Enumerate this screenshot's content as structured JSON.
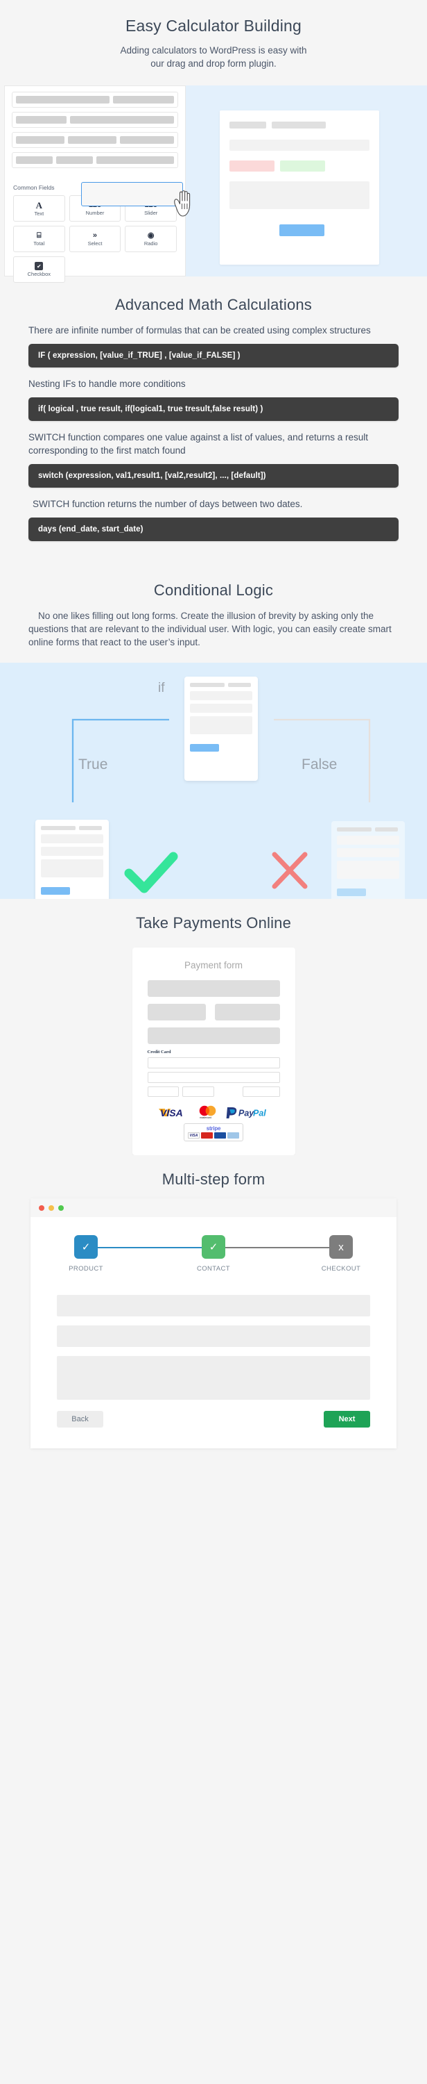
{
  "sections": {
    "calculator": {
      "title": "Easy Calculator Building",
      "subtitle": "Adding calculators to WordPress is easy with our drag and drop form plugin.",
      "builder": {
        "group_label": "Common Fields",
        "chevron": "⌄",
        "fields": [
          {
            "glyph": "A",
            "label": "Text"
          },
          {
            "glyph": "123",
            "label": "Number"
          },
          {
            "glyph": "123",
            "label": "Slider"
          },
          {
            "glyph": "⌸",
            "label": "Total"
          },
          {
            "glyph": "»",
            "label": "Select"
          },
          {
            "glyph": "◉",
            "label": "Radio"
          },
          {
            "glyph": "✔",
            "label": "Checkbox"
          }
        ]
      },
      "colors": {
        "panel_bg": "#e3f0fc",
        "drag_outline": "#4a9ae8",
        "submit_button": "#79bcf5",
        "error_field": "#fbd9d9",
        "success_field": "#ddf7dd"
      }
    },
    "math": {
      "title": "Advanced Math Calculations",
      "paragraphs": [
        "There are infinite number of formulas that can be created using complex structures",
        "Nesting IFs to handle more conditions",
        "SWITCH function compares one value against a list of values, and returns a result corresponding to the first match found",
        "SWITCH function returns the number of days between two dates."
      ],
      "code_blocks": [
        "IF ( expression, [value_if_TRUE] , [value_if_FALSE] )",
        "if( logical , true result, if(logical1, true tresult,false result) )",
        "switch (expression, val1,result1, [val2,result2], ..., [default])",
        "days (end_date, start_date)"
      ],
      "code_bg": "#3f3f3f"
    },
    "logic": {
      "title": "Conditional Logic",
      "subtitle": "No one likes filling out long forms. Create the illusion of brevity by asking only the questions that are relevant to the individual user. With logic, you can easily create smart online forms that react to the user’s input.",
      "diagram": {
        "if_label": "if",
        "true_label": "True",
        "false_label": "False",
        "true_color": "#6cb6ef",
        "false_color": "#e6e0dc",
        "check_color": "#35e59a",
        "cross_color": "#f2807e",
        "stage_bg": "#ddeefc"
      }
    },
    "payments": {
      "title": "Take Payments Online",
      "form_title": "Payment form",
      "credit_card_label": "Credit Card",
      "logos": [
        "VISA",
        "mastercard",
        "PayPal"
      ],
      "stripe": {
        "word": "stripe",
        "cards": [
          "VISA",
          "MasterCard",
          "Maestro",
          "AmEx"
        ]
      }
    },
    "multistep": {
      "title": "Multi-step form",
      "window_dots": [
        "#f25c4c",
        "#f5bf4b",
        "#51c94f"
      ],
      "steps": [
        {
          "label": "PRODUCT",
          "mark": "✓",
          "color": "#2b8cc4",
          "state": "done"
        },
        {
          "label": "CONTACT",
          "mark": "✓",
          "color": "#53bd6e",
          "state": "done"
        },
        {
          "label": "CHECKOUT",
          "mark": "x",
          "color": "#7d7d7d",
          "state": "pending"
        }
      ],
      "connectors": [
        "#2b8cc4",
        "#7d7d7d"
      ],
      "back_label": "Back",
      "next_label": "Next",
      "next_color": "#1ea356"
    }
  }
}
